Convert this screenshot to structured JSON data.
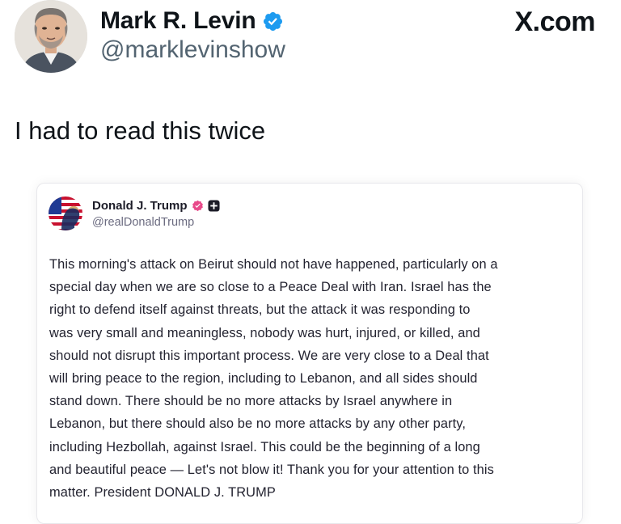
{
  "outer_post": {
    "display_name": "Mark R. Levin",
    "handle": "@marklevinshow",
    "verified_icon": "verified-badge-icon",
    "avatar_icon": "profile-photo",
    "brand": "X.com",
    "text": "I had to read this twice"
  },
  "embedded_post": {
    "display_name": "Donald J. Trump",
    "handle": "@realDonaldTrump",
    "verified_icon": "verified-badge-icon",
    "extra_icon": "plus-badge-icon",
    "avatar_icon": "profile-photo",
    "body_lines": [
      "This morning's attack on Beirut should not have happened, particularly on a",
      "special day when we are so close to a Peace Deal with Iran. Israel has the",
      "right to defend itself against threats, but the attack it was responding to",
      "was very small and meaningless, nobody was hurt, injured, or killed, and",
      "should not disrupt this important process. We are very close to a Deal that",
      "will bring peace to the region, including to Lebanon, and all sides should",
      "stand down. There should be no more attacks by Israel anywhere in",
      "Lebanon, but there should also be no more attacks by any other party,",
      "including Hezbollah, against Israel. This could be the beginning of a long",
      "and beautiful peace — Let's not blow it! Thank you for your attention to this",
      "matter. President DONALD J. TRUMP"
    ]
  },
  "colors": {
    "x_blue_badge": "#1d9bf0",
    "truth_badge": "#e84a8a",
    "secondary_text": "#536471"
  }
}
